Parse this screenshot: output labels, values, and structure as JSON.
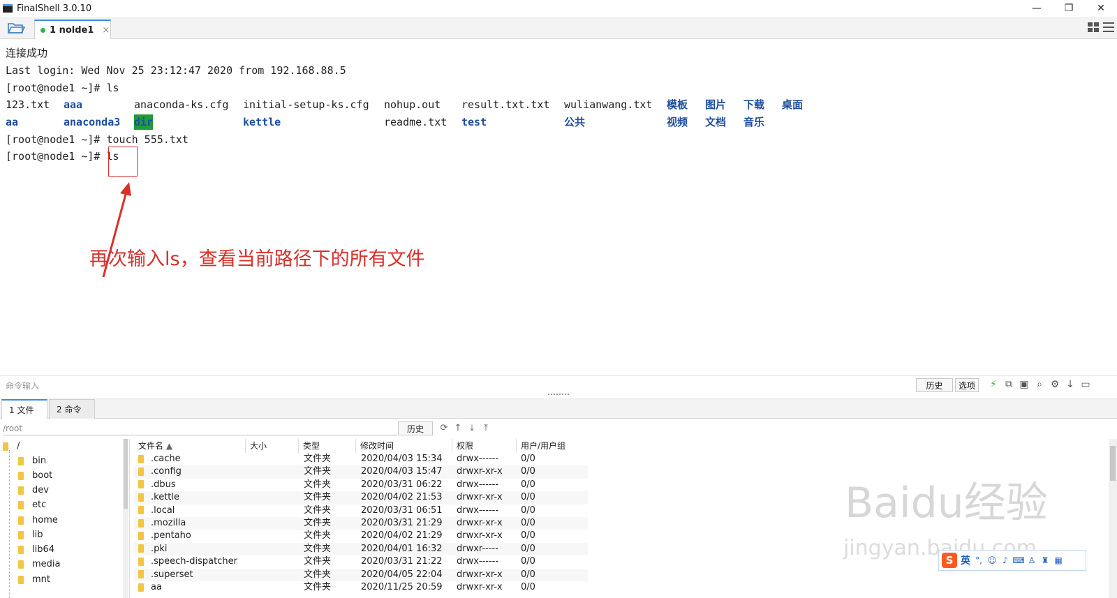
{
  "window": {
    "title": "FinalShell 3.0.10",
    "controls": {
      "minimize": "—",
      "restore": "❐",
      "close": "✕"
    }
  },
  "tabs": [
    {
      "label": "1 nolde1",
      "status_color": "#2fb84a",
      "close": "×"
    }
  ],
  "terminal": {
    "lines": {
      "connected": "连接成功",
      "last_login": "Last login: Wed Nov 25 23:12:47 2020 from 192.168.88.5",
      "prompt1": "[root@node1 ~]# ls",
      "prompt2": "[root@node1 ~]# touch 555.txt",
      "prompt3_prefix": "[root@node1 ~]# ",
      "prompt3_cmd": "ls"
    },
    "ls_row1": {
      "c1": "123.txt",
      "c2": "aaa",
      "c3": "anaconda-ks.cfg",
      "c4": "initial-setup-ks.cfg",
      "c5": "nohup.out",
      "c6": "result.txt.txt",
      "c7": "wulianwang.txt",
      "c8": "模板",
      "c9": "图片",
      "c10": "下载",
      "c11": "桌面"
    },
    "ls_row2": {
      "c1": "aa",
      "c2": "anaconda3",
      "c3": "dir",
      "c4": "kettle",
      "c5": "readme.txt",
      "c6": "test",
      "c7": "公共",
      "c8": "视频",
      "c9": "文档",
      "c10": "音乐"
    },
    "annotation": "再次输入ls，查看当前路径下的所有文件",
    "colors": {
      "dir_blue": "#1d4d9e",
      "dir_highlight": "#1f9b39",
      "annotation_red": "#d9302a"
    }
  },
  "command_bar": {
    "placeholder": "命令输入",
    "history_label": "历史",
    "options_label": "选项"
  },
  "bottom_tabs": [
    {
      "label": "1 文件"
    },
    {
      "label": "2 命令"
    }
  ],
  "file_panel": {
    "path": "/root",
    "history_label": "历史",
    "tree": {
      "root": "/",
      "items": [
        "bin",
        "boot",
        "dev",
        "etc",
        "home",
        "lib",
        "lib64",
        "media",
        "mnt"
      ]
    },
    "columns": {
      "name": "文件名",
      "size": "大小",
      "type": "类型",
      "modified": "修改时间",
      "perm": "权限",
      "owner": "用户/用户组"
    },
    "rows": [
      {
        "name": ".cache",
        "type": "文件夹",
        "modified": "2020/04/03 15:34",
        "perm": "drwx------",
        "owner": "0/0"
      },
      {
        "name": ".config",
        "type": "文件夹",
        "modified": "2020/04/03 15:47",
        "perm": "drwxr-xr-x",
        "owner": "0/0"
      },
      {
        "name": ".dbus",
        "type": "文件夹",
        "modified": "2020/03/31 06:22",
        "perm": "drwx------",
        "owner": "0/0"
      },
      {
        "name": ".kettle",
        "type": "文件夹",
        "modified": "2020/04/02 21:53",
        "perm": "drwxr-xr-x",
        "owner": "0/0"
      },
      {
        "name": ".local",
        "type": "文件夹",
        "modified": "2020/03/31 06:51",
        "perm": "drwx------",
        "owner": "0/0"
      },
      {
        "name": ".mozilla",
        "type": "文件夹",
        "modified": "2020/03/31 21:29",
        "perm": "drwxr-xr-x",
        "owner": "0/0"
      },
      {
        "name": ".pentaho",
        "type": "文件夹",
        "modified": "2020/04/02 21:29",
        "perm": "drwxr-xr-x",
        "owner": "0/0"
      },
      {
        "name": ".pki",
        "type": "文件夹",
        "modified": "2020/04/01 16:32",
        "perm": "drwxr-----",
        "owner": "0/0"
      },
      {
        "name": ".speech-dispatcher",
        "type": "文件夹",
        "modified": "2020/03/31 21:22",
        "perm": "drwx------",
        "owner": "0/0"
      },
      {
        "name": ".superset",
        "type": "文件夹",
        "modified": "2020/04/05 22:04",
        "perm": "drwxr-xr-x",
        "owner": "0/0"
      },
      {
        "name": "aa",
        "type": "文件夹",
        "modified": "2020/11/25 20:59",
        "perm": "drwxr-xr-x",
        "owner": "0/0"
      }
    ]
  },
  "watermark": {
    "logo": "Baidu经验",
    "url": "jingyan.baidu.com"
  },
  "ime": {
    "logo": "S",
    "mode": "英"
  }
}
